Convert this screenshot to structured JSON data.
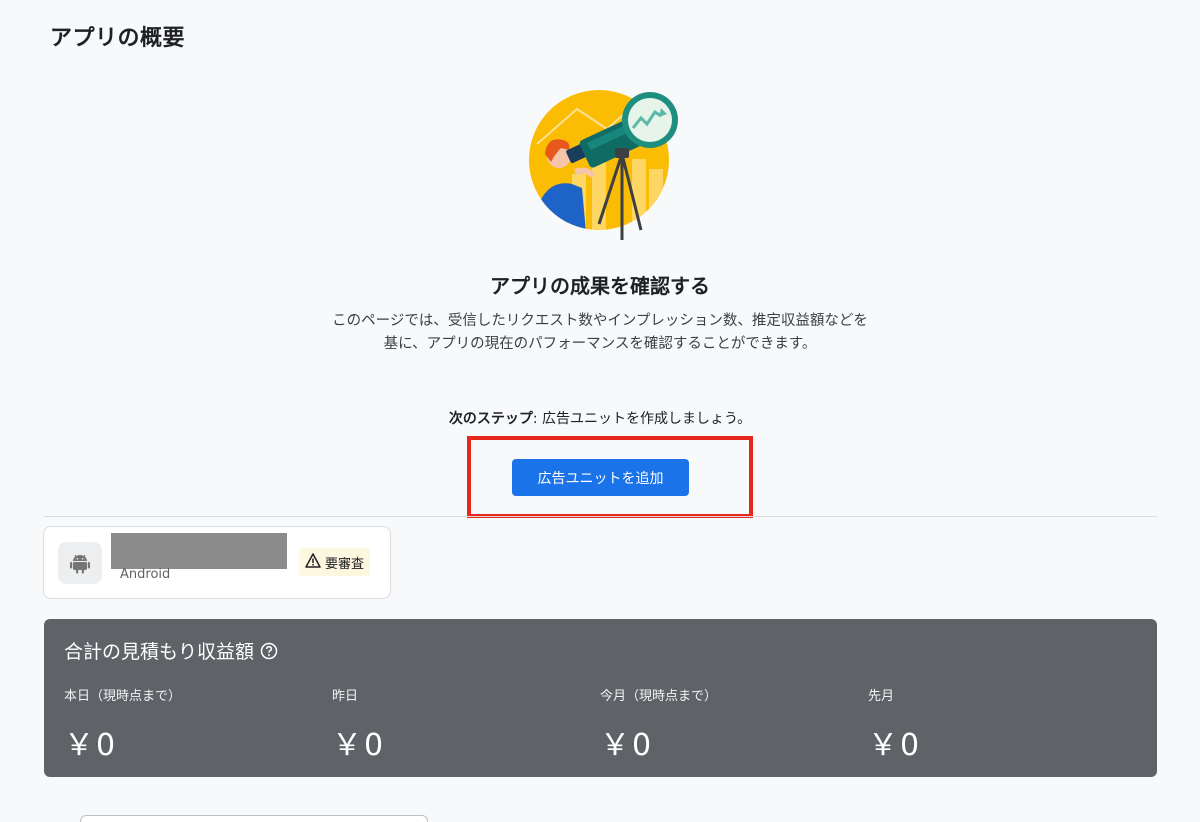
{
  "page": {
    "title": "アプリの概要"
  },
  "hero": {
    "heading": "アプリの成果を確認する",
    "description": "このページでは、受信したリクエスト数やインプレッション数、推定収益額などを基に、アプリの現在のパフォーマンスを確認することができます。",
    "next_step_label": "次のステップ",
    "next_step_text": ": 広告ユニットを作成しましょう。",
    "add_button": "広告ユニットを追加"
  },
  "app_card": {
    "platform": "Android",
    "badge": "要審査",
    "icon": "android-icon",
    "badge_icon": "warning-icon"
  },
  "earnings": {
    "title": "合計の見積もり収益額",
    "help_icon": "help-icon",
    "stats": [
      {
        "label": "本日（現時点まで）",
        "value": "￥0"
      },
      {
        "label": "昨日",
        "value": "￥0"
      },
      {
        "label": "今月（現時点まで）",
        "value": "￥0"
      },
      {
        "label": "先月",
        "value": "￥0"
      }
    ]
  },
  "colors": {
    "primary": "#1a73e8",
    "highlight": "#e8281d",
    "earnings_bg": "#5f6368",
    "badge_bg": "#fef7e0"
  }
}
